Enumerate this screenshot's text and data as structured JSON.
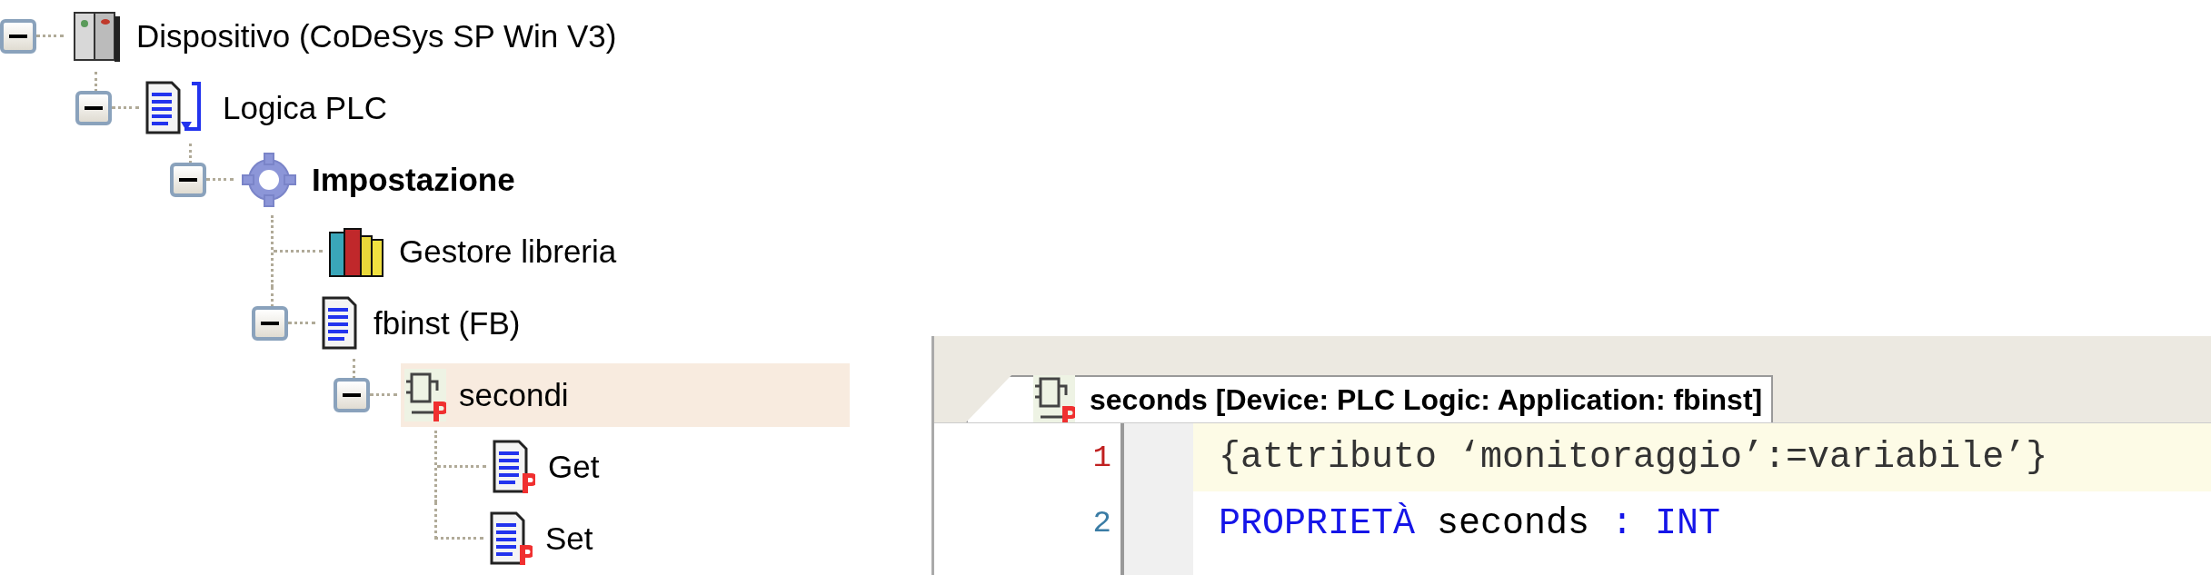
{
  "tree": [
    {
      "label": "Dispositivo (CoDeSys SP Win V3)",
      "kind": "device",
      "expanded": true,
      "bold": false,
      "selected": false,
      "children": [
        {
          "label": "Logica PLC",
          "kind": "logic",
          "expanded": true,
          "bold": false,
          "selected": false,
          "children": [
            {
              "label": "Impostazione",
              "kind": "gear",
              "expanded": true,
              "bold": true,
              "selected": false,
              "children": [
                {
                  "label": "Gestore libreria",
                  "kind": "library",
                  "bold": false,
                  "selected": false
                },
                {
                  "label": "fbinst (FB)",
                  "kind": "pou",
                  "expanded": true,
                  "bold": false,
                  "selected": false,
                  "children": [
                    {
                      "label": "secondi",
                      "kind": "property",
                      "expanded": true,
                      "bold": false,
                      "selected": true,
                      "children": [
                        {
                          "label": "Get",
                          "kind": "accessor",
                          "bold": false,
                          "selected": false
                        },
                        {
                          "label": "Set",
                          "kind": "accessor",
                          "bold": false,
                          "selected": false
                        }
                      ]
                    }
                  ]
                }
              ]
            }
          ]
        }
      ]
    }
  ],
  "editor": {
    "tab": {
      "kind": "property",
      "title": "seconds [Device: PLC Logic: Application: fbinst]"
    },
    "lines": [
      {
        "number": "1",
        "current": true,
        "tokens": [
          {
            "kind": "pragma",
            "text": "{attributo ‘monitoraggio’:=variabile’}"
          }
        ]
      },
      {
        "number": "2",
        "current": false,
        "tokens": [
          {
            "kind": "keyword",
            "text": "PROPRIETÀ"
          },
          {
            "kind": "plain",
            "text": " seconds"
          },
          {
            "kind": "keyword",
            "text": " : "
          },
          {
            "kind": "keyword",
            "text": "INT"
          }
        ]
      }
    ]
  }
}
